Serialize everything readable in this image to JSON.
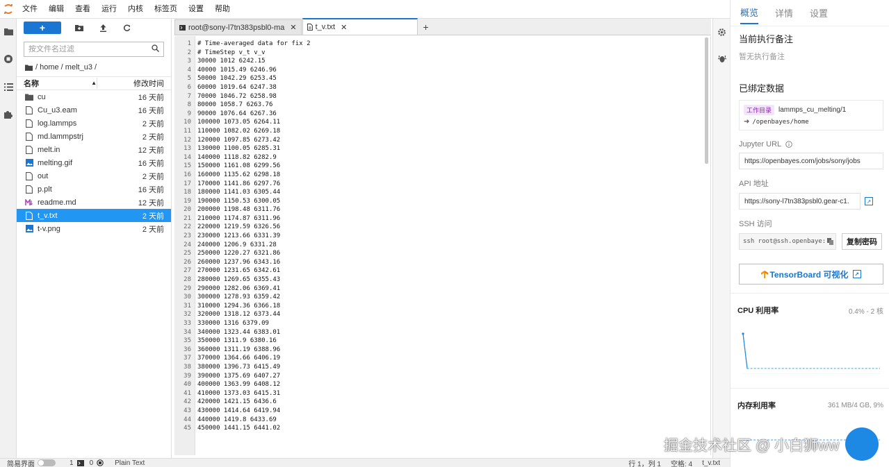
{
  "menu": [
    "文件",
    "编辑",
    "查看",
    "运行",
    "内核",
    "标签页",
    "设置",
    "帮助"
  ],
  "toolbar": {
    "new_label": "+"
  },
  "filebrowser": {
    "filter_placeholder": "按文件名过滤",
    "breadcrumb": "/ home / melt_u3 /",
    "col_name": "名称",
    "col_time": "修改时间",
    "files": [
      {
        "name": "cu",
        "time": "16 天前",
        "icon": "folder-icon",
        "selected": false
      },
      {
        "name": "Cu_u3.eam",
        "time": "16 天前",
        "icon": "file-icon",
        "selected": false
      },
      {
        "name": "log.lammps",
        "time": "2 天前",
        "icon": "file-icon",
        "selected": false
      },
      {
        "name": "md.lammpstrj",
        "time": "2 天前",
        "icon": "file-icon",
        "selected": false
      },
      {
        "name": "melt.in",
        "time": "12 天前",
        "icon": "file-icon",
        "selected": false
      },
      {
        "name": "melting.gif",
        "time": "16 天前",
        "icon": "image-icon",
        "selected": false
      },
      {
        "name": "out",
        "time": "2 天前",
        "icon": "file-icon",
        "selected": false
      },
      {
        "name": "p.plt",
        "time": "16 天前",
        "icon": "file-icon",
        "selected": false
      },
      {
        "name": "readme.md",
        "time": "12 天前",
        "icon": "markdown-icon",
        "selected": false
      },
      {
        "name": "t_v.txt",
        "time": "2 天前",
        "icon": "file-icon",
        "selected": true
      },
      {
        "name": "t-v.png",
        "time": "2 天前",
        "icon": "image-icon",
        "selected": false
      }
    ]
  },
  "tabs": [
    {
      "label": "root@sony-l7tn383psbl0-ma",
      "icon": "terminal-icon",
      "active": false
    },
    {
      "label": "t_v.txt",
      "icon": "file-icon",
      "active": true
    }
  ],
  "editor": {
    "lines": [
      "# Time-averaged data for fix 2",
      "# TimeStep v_t v_v",
      "30000 1012 6242.15",
      "40000 1015.49 6246.96",
      "50000 1042.29 6253.45",
      "60000 1019.64 6247.38",
      "70000 1046.72 6258.98",
      "80000 1058.7 6263.76",
      "90000 1076.64 6267.36",
      "100000 1073.05 6264.11",
      "110000 1082.02 6269.18",
      "120000 1097.85 6273.42",
      "130000 1100.05 6285.31",
      "140000 1118.82 6282.9",
      "150000 1161.08 6299.56",
      "160000 1135.62 6298.18",
      "170000 1141.86 6297.76",
      "180000 1141.03 6305.44",
      "190000 1150.53 6300.05",
      "200000 1198.48 6311.76",
      "210000 1174.87 6311.96",
      "220000 1219.59 6326.56",
      "230000 1213.66 6331.39",
      "240000 1206.9 6331.28",
      "250000 1220.27 6321.86",
      "260000 1237.96 6343.16",
      "270000 1231.65 6342.61",
      "280000 1269.65 6355.43",
      "290000 1282.06 6369.41",
      "300000 1278.93 6359.42",
      "310000 1294.36 6366.18",
      "320000 1318.12 6373.44",
      "330000 1316 6379.09",
      "340000 1323.44 6383.01",
      "350000 1311.9 6380.16",
      "360000 1311.19 6388.96",
      "370000 1364.66 6406.19",
      "380000 1396.73 6415.49",
      "390000 1375.69 6407.27",
      "400000 1363.99 6408.12",
      "410000 1373.03 6415.31",
      "420000 1421.15 6436.6",
      "430000 1414.64 6419.94",
      "440000 1419.8 6433.69",
      "450000 1441.15 6441.02"
    ]
  },
  "panel": {
    "tabs": [
      "概览",
      "详情",
      "设置"
    ],
    "current_note_title": "当前执行备注",
    "current_note_empty": "暂无执行备注",
    "bound_title": "已绑定数据",
    "bound_badge": "工作目录",
    "bound_name": "lammps_cu_melting/1",
    "bound_path": "/openbayes/home",
    "jupyter_label": "Jupyter URL",
    "jupyter_url": "https://openbayes.com/jobs/sony/jobs",
    "api_label": "API 地址",
    "api_url": "https://sony-l7tn383psbl0.gear-c1.",
    "ssh_label": "SSH 访问",
    "ssh_value": "ssh root@ssh.openbaye:",
    "copy_label": "复制密码",
    "tensorboard_label": "TensorBoard 可视化",
    "cpu_title": "CPU 利用率",
    "cpu_value": "0.4% - 2 核",
    "mem_title": "内存利用率",
    "mem_value": "361 MB/4 GB, 9%"
  },
  "status": {
    "simple_mode": "简易界面",
    "terminals": "1",
    "kernels": "0",
    "file_type": "Plain Text",
    "position": "行 1，列 1",
    "spaces": "空格: 4",
    "file_name": "t_v.txt"
  },
  "watermark": "掘金技术社区 @ 小白狮ww",
  "colors": {
    "accent": "#1976d2",
    "selected_row": "#2196f3",
    "logo": "#f37726"
  }
}
